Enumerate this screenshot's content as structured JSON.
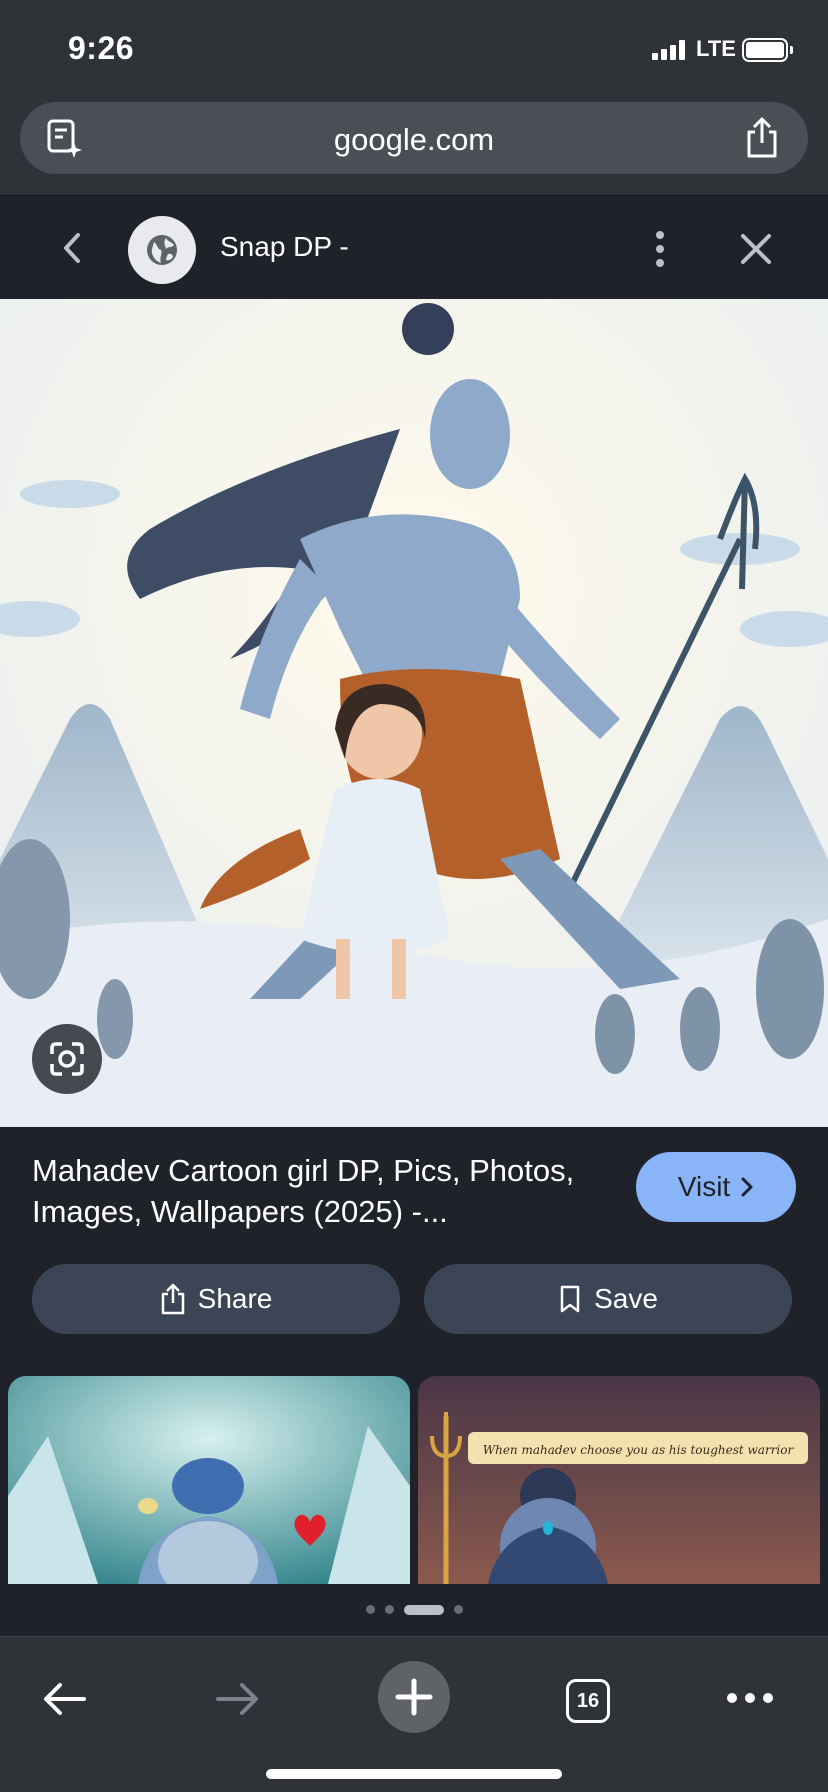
{
  "status_bar": {
    "time": "9:26",
    "network": "LTE"
  },
  "browser": {
    "url": "google.com",
    "icons": {
      "reader": "reader-mode-icon",
      "share": "share-icon"
    }
  },
  "panel": {
    "site_title": "Snap DP -",
    "icons": {
      "back": "chevron-left-icon",
      "favicon": "globe-icon",
      "menu": "more-vert-icon",
      "close": "close-icon"
    }
  },
  "result": {
    "title": "Mahadev Cartoon girl DP, Pics, Photos, Images, Wallpapers (2025) -...",
    "visit_label": "Visit",
    "share_label": "Share",
    "save_label": "Save"
  },
  "related": [
    {
      "caption": ""
    },
    {
      "caption": "When mahadev choose you as his toughest warrior"
    }
  ],
  "pagination": {
    "count": 4,
    "active": 2
  },
  "toolbar": {
    "tab_count": "16"
  },
  "colors": {
    "accent": "#8ab4f8",
    "bg": "#1f2329",
    "chrome": "#2f3236",
    "button": "#3b4555"
  }
}
